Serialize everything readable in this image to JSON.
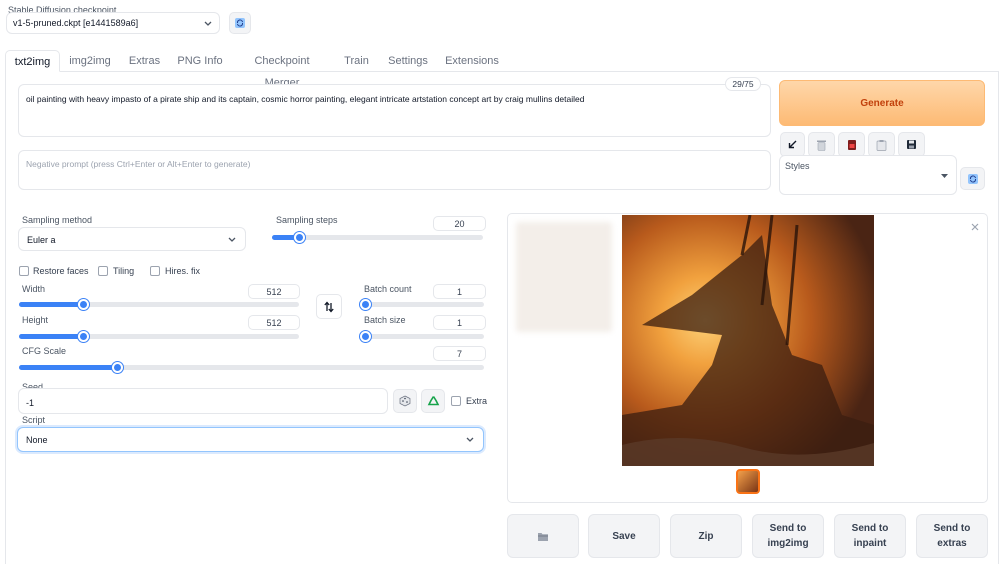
{
  "checkpoint": {
    "label": "Stable Diffusion checkpoint",
    "value": "v1-5-pruned.ckpt [e1441589a6]"
  },
  "tabs": [
    {
      "label": "txt2img",
      "active": true
    },
    {
      "label": "img2img"
    },
    {
      "label": "Extras"
    },
    {
      "label": "PNG Info"
    },
    {
      "label": "Checkpoint Merger"
    },
    {
      "label": "Train"
    },
    {
      "label": "Settings"
    },
    {
      "label": "Extensions"
    }
  ],
  "prompt": {
    "value": "oil painting with heavy impasto of a pirate ship and its captain, cosmic horror painting, elegant intricate artstation concept art by craig mullins detailed",
    "token_count": "29/75"
  },
  "negative_prompt": {
    "placeholder": "Negative prompt (press Ctrl+Enter or Alt+Enter to generate)"
  },
  "generate_label": "Generate",
  "styles": {
    "label": "Styles",
    "value": ""
  },
  "sampling": {
    "method_label": "Sampling method",
    "method_value": "Euler a",
    "steps_label": "Sampling steps",
    "steps_value": "20",
    "steps_fraction": 0.13
  },
  "checkboxes": {
    "restore_faces": "Restore faces",
    "tiling": "Tiling",
    "hires_fix": "Hires. fix",
    "extra": "Extra"
  },
  "width": {
    "label": "Width",
    "value": "512",
    "fraction": 0.23
  },
  "height": {
    "label": "Height",
    "value": "512",
    "fraction": 0.23
  },
  "batch_count": {
    "label": "Batch count",
    "value": "1",
    "fraction": 0.0
  },
  "batch_size": {
    "label": "Batch size",
    "value": "1",
    "fraction": 0.0
  },
  "cfg_scale": {
    "label": "CFG Scale",
    "value": "7",
    "fraction": 0.21
  },
  "seed": {
    "label": "Seed",
    "value": "-1"
  },
  "script": {
    "label": "Script",
    "value": "None"
  },
  "output_buttons": {
    "save": "Save",
    "zip": "Zip",
    "send_img2img": "Send to img2img",
    "send_inpaint": "Send to inpaint",
    "send_extras": "Send to extras"
  },
  "colors": {
    "accent": "#3b82f6",
    "generate_from": "#fed7aa",
    "generate_to": "#fdba74",
    "generate_text": "#c2410c"
  },
  "icons": {
    "refresh": "refresh-icon",
    "arrow": "arrow-down-left-icon",
    "trash": "trash-icon",
    "card": "red-card-icon",
    "clipboard": "clipboard-icon",
    "save": "floppy-disk-icon",
    "swap": "swap-icon",
    "dice": "dice-icon",
    "recycle": "recycle-icon",
    "folder": "folder-icon",
    "close": "close-icon"
  }
}
